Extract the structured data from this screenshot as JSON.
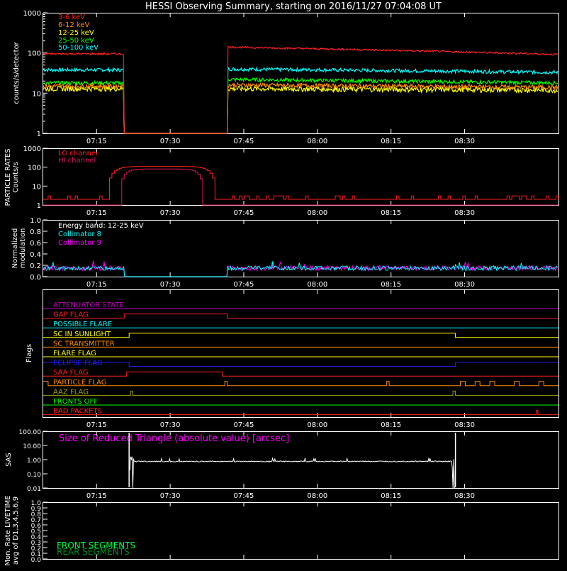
{
  "title": "HESSI Observing Summary, starting on 2016/11/27 07:04:08 UT",
  "x_ticks": [
    "07:15",
    "07:30",
    "07:45",
    "08:00",
    "08:15",
    "08:30"
  ],
  "chart_data": [
    {
      "id": "counts",
      "type": "line",
      "ylabel": "counts/s/detector",
      "yscale": "log",
      "ylim": [
        1,
        1000
      ],
      "y_ticks": [
        "1",
        "10",
        "100",
        "1000"
      ],
      "gap_minutes": [
        16.5,
        37.5
      ],
      "series": [
        {
          "name": "3-6 keV",
          "color": "#ff2020",
          "before": 95,
          "after_start": 140,
          "after_end": 92,
          "noise": 0.05
        },
        {
          "name": "6-12 keV",
          "color": "#ff8c00",
          "before": 15,
          "after_start": 16,
          "after_end": 14,
          "noise": 0.12
        },
        {
          "name": "12-25 keV",
          "color": "#ffff00",
          "before": 13,
          "after_start": 13,
          "after_end": 12,
          "noise": 0.15
        },
        {
          "name": "25-50 keV",
          "color": "#00ff00",
          "before": 18,
          "after_start": 22,
          "after_end": 18,
          "noise": 0.1
        },
        {
          "name": "50-100 keV",
          "color": "#00ffff",
          "before": 38,
          "after_start": 40,
          "after_end": 33,
          "noise": 0.1
        }
      ]
    },
    {
      "id": "particle",
      "type": "line",
      "ylabel_lines": [
        "PARTICLE RATES",
        "Counts/s"
      ],
      "yscale": "log",
      "ylim": [
        1,
        1000
      ],
      "y_ticks": [
        "1",
        "10",
        "100",
        "1000"
      ],
      "series": [
        {
          "name": "LO channel",
          "color": "#ff2020"
        },
        {
          "name": "HI channel",
          "color": "#e0185a"
        }
      ]
    },
    {
      "id": "modulation",
      "type": "line",
      "ylabel_lines": [
        "Normalized",
        "modulation"
      ],
      "ylim": [
        0,
        1
      ],
      "y_ticks": [
        "0.0",
        "0.2",
        "0.4",
        "0.6",
        "0.8",
        "1.0"
      ],
      "legend_header": "Energy band: 12-25 keV",
      "series": [
        {
          "name": "Collimator 8",
          "color": "#00ffff"
        },
        {
          "name": "Collimator 9",
          "color": "#ff00ff"
        }
      ]
    },
    {
      "id": "flags",
      "type": "line",
      "ylabel": "Flags",
      "flags": [
        {
          "name": "ATTENUATOR STATE",
          "color": "#c000c0"
        },
        {
          "name": "GAP FLAG",
          "color": "#ff2020"
        },
        {
          "name": "POSSIBLE FLARE",
          "color": "#00ffff"
        },
        {
          "name": "SC IN SUNLIGHT",
          "color": "#ffff00"
        },
        {
          "name": "SC TRANSMITTER",
          "color": "#ff8c00"
        },
        {
          "name": "FLARE FLAG",
          "color": "#ffff00"
        },
        {
          "name": "ECLIPSE FLAG",
          "color": "#2020ff"
        },
        {
          "name": "SAA FLAG",
          "color": "#ff2020"
        },
        {
          "name": "PARTICLE FLAG",
          "color": "#ff8c00"
        },
        {
          "name": "AAZ FLAG",
          "color": "#a0a000"
        },
        {
          "name": "FRONTS OFF",
          "color": "#00ff00"
        },
        {
          "name": "BAD PACKETS",
          "color": "#ff2020"
        }
      ]
    },
    {
      "id": "sas",
      "type": "line",
      "ylabel": "SAS",
      "yscale": "log",
      "ylim": [
        0.01,
        100
      ],
      "y_ticks": [
        "0.01",
        "0.10",
        "1.00",
        "10.00",
        "100.00"
      ],
      "annotation": "Size of Reduced Triangle (absolute value) [arcsec]",
      "annotation_color": "#ff00ff",
      "level": 0.75
    },
    {
      "id": "livetime",
      "type": "line",
      "ylabel_lines": [
        "Mon. Rate LIVETIME",
        "avg of D1,3,4,5,6,9"
      ],
      "ylim": [
        0,
        1
      ],
      "y_ticks": [
        "0.0",
        "0.1",
        "0.2",
        "0.3",
        "0.4",
        "0.5",
        "0.6",
        "0.7",
        "0.8",
        "0.9",
        "1.0"
      ],
      "series": [
        {
          "name": "FRONT SEGMENTS",
          "color": "#00ff40"
        },
        {
          "name": "REAR SEGMENTS",
          "color": "#008c20"
        }
      ]
    }
  ]
}
